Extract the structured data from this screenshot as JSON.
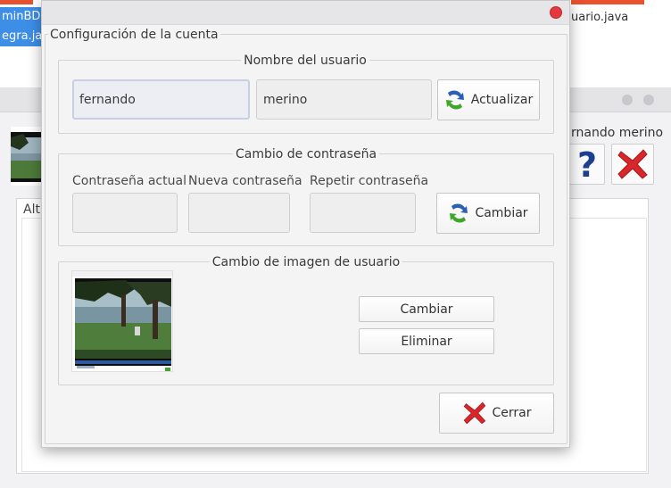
{
  "background": {
    "tabs": [
      "minBDLis",
      "egra.java"
    ],
    "file_tab": "uario.java",
    "user_label": "rnando merino",
    "panel_label": "Alt"
  },
  "dialog": {
    "group_title": "Configuración de la cuenta",
    "username_section": {
      "title": "Nombre del usuario",
      "first_name": "fernando",
      "last_name": "merino",
      "update_button": "Actualizar"
    },
    "password_section": {
      "title": "Cambio de contraseña",
      "current_label": "Contraseña actual",
      "new_label": "Nueva contraseña",
      "repeat_label": "Repetir contraseña",
      "current_value": "",
      "new_value": "",
      "repeat_value": "",
      "change_button": "Cambiar"
    },
    "image_section": {
      "title": "Cambio de imagen de usuario",
      "change_button": "Cambiar",
      "delete_button": "Eliminar"
    },
    "close_button": "Cerrar"
  },
  "colors": {
    "close_dot": "#e2383f",
    "background_tab_blue": "#3d8ee6",
    "background_accent_orange": "#e8502e"
  },
  "icons": [
    "refresh-icon",
    "close-x-icon",
    "help-icon",
    "window-close-dot-icon"
  ]
}
